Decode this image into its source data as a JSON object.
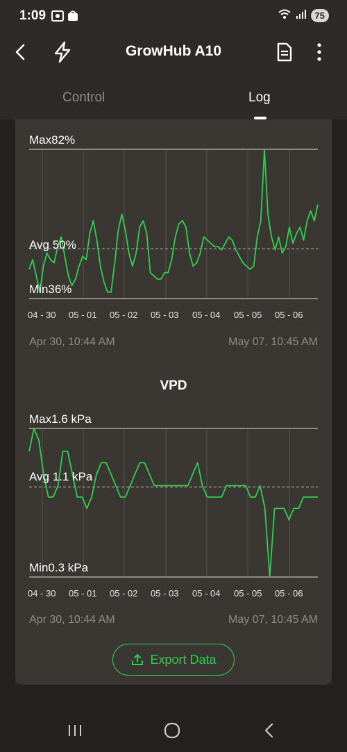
{
  "status_bar": {
    "time": "1:09",
    "battery": "75",
    "network": "6"
  },
  "app_bar": {
    "title": "GrowHub A10",
    "back_icon": "chevron-left-icon",
    "flash_icon": "lightning-icon",
    "doc_icon": "document-icon",
    "more_icon": "more-vertical-icon"
  },
  "tabs": [
    {
      "label": "Control",
      "active": false
    },
    {
      "label": "Log",
      "active": true
    }
  ],
  "humidity_chart": {
    "max_label": "Max82%",
    "avg_label": "Avg 50%",
    "min_label": "Min36%",
    "range_start": "Apr 30, 10:44 AM",
    "range_end": "May 07, 10:45 AM"
  },
  "vpd_chart": {
    "title": "VPD",
    "max_label": "Max1.6 kPa",
    "avg_label": "Avg 1.1 kPa",
    "min_label": "Min0.3 kPa",
    "range_start": "Apr 30, 10:44 AM",
    "range_end": "May 07, 10:45 AM"
  },
  "x_ticks": [
    "04 - 30",
    "05 - 01",
    "05 - 02",
    "05 - 03",
    "05 - 04",
    "05 - 05",
    "05 - 06"
  ],
  "export_button": {
    "label": "Export Data",
    "icon": "upload-icon"
  },
  "colors": {
    "accent": "#2fcf4f",
    "background": "#2d2b28",
    "panel": "#3a3733"
  },
  "chart_data": [
    {
      "type": "line",
      "title": "",
      "series": [
        {
          "values": [
            45,
            48,
            43,
            38,
            46,
            50,
            48,
            47,
            52,
            55,
            49,
            43,
            40,
            42,
            46,
            49,
            48,
            56,
            60,
            54,
            46,
            41,
            38,
            38,
            47,
            57,
            62,
            57,
            50,
            46,
            50,
            58,
            60,
            56,
            44,
            43,
            42,
            42,
            44,
            44,
            48,
            55,
            59,
            60,
            58,
            50,
            46,
            47,
            50,
            55,
            54,
            53,
            52,
            52,
            51,
            53,
            55,
            54,
            51,
            49,
            47,
            46,
            45,
            46,
            55,
            60,
            82,
            62,
            55,
            51,
            55,
            50,
            52,
            58,
            53,
            56,
            58,
            54,
            60,
            63,
            60,
            65
          ]
        }
      ],
      "ylim": [
        36,
        82
      ],
      "categories": [
        "04 - 30",
        "05 - 01",
        "05 - 02",
        "05 - 03",
        "05 - 04",
        "05 - 05",
        "05 - 06"
      ]
    },
    {
      "type": "line",
      "title": "VPD",
      "series": [
        {
          "values": [
            1.4,
            1.6,
            1.5,
            1.2,
            1.0,
            1.0,
            1.1,
            1.4,
            1.4,
            1.2,
            1.0,
            1.0,
            0.9,
            1.0,
            1.2,
            1.3,
            1.3,
            1.2,
            1.1,
            1.0,
            1.0,
            1.1,
            1.2,
            1.3,
            1.3,
            1.2,
            1.1,
            1.1,
            1.1,
            1.1,
            1.1,
            1.1,
            1.1,
            1.1,
            1.2,
            1.3,
            1.1,
            1.0,
            1.0,
            1.0,
            1.0,
            1.1,
            1.1,
            1.1,
            1.1,
            1.1,
            1.0,
            1.0,
            1.1,
            0.9,
            0.3,
            0.9,
            0.9,
            0.9,
            0.8,
            0.9,
            0.9,
            1.0,
            1.0,
            1.0,
            1.0
          ]
        }
      ],
      "ylim": [
        0.3,
        1.6
      ],
      "categories": [
        "04 - 30",
        "05 - 01",
        "05 - 02",
        "05 - 03",
        "05 - 04",
        "05 - 05",
        "05 - 06"
      ]
    }
  ]
}
